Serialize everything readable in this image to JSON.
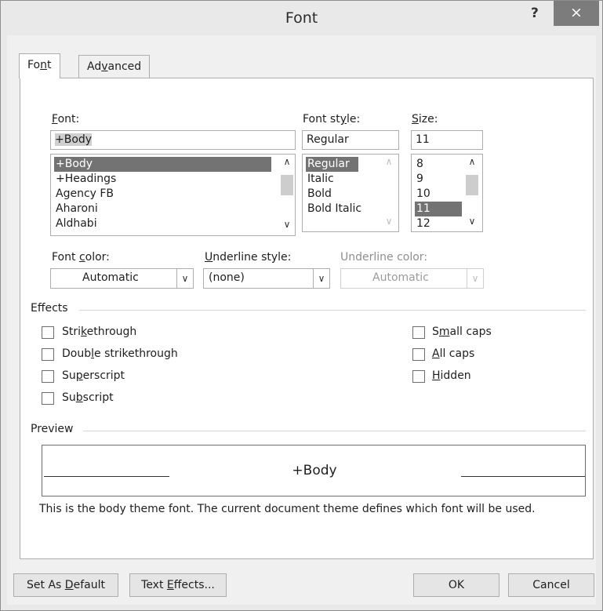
{
  "window": {
    "title": "Font",
    "help_icon": "?",
    "close_icon": "×"
  },
  "tabs": [
    {
      "label": "Font",
      "active": true
    },
    {
      "label": "Advanced",
      "active": false
    }
  ],
  "font": {
    "label": "Font:",
    "value": "+Body",
    "items": [
      "+Body",
      "+Headings",
      "Agency FB",
      "Aharoni",
      "Aldhabi"
    ],
    "selected": "+Body"
  },
  "font_style": {
    "label": "Font style:",
    "value": "Regular",
    "items": [
      "Regular",
      "Italic",
      "Bold",
      "Bold Italic"
    ],
    "selected": "Regular"
  },
  "size": {
    "label": "Size:",
    "value": "11",
    "items": [
      "8",
      "9",
      "10",
      "11",
      "12"
    ],
    "selected": "11"
  },
  "font_color": {
    "label": "Font color:",
    "value": "Automatic"
  },
  "underline_style": {
    "label": "Underline style:",
    "value": "(none)"
  },
  "underline_color": {
    "label": "Underline color:",
    "value": "Automatic",
    "disabled": true
  },
  "effects": {
    "heading": "Effects",
    "left": [
      {
        "label": "Strikethrough",
        "checked": false
      },
      {
        "label": "Double strikethrough",
        "checked": false
      },
      {
        "label": "Superscript",
        "checked": false
      },
      {
        "label": "Subscript",
        "checked": false
      }
    ],
    "right": [
      {
        "label": "Small caps",
        "checked": false
      },
      {
        "label": "All caps",
        "checked": false
      },
      {
        "label": "Hidden",
        "checked": false
      }
    ]
  },
  "preview": {
    "heading": "Preview",
    "sample": "+Body",
    "description": "This is the body theme font. The current document theme defines which font will be used."
  },
  "buttons": {
    "set_default": "Set As Default",
    "text_effects": "Text Effects...",
    "ok": "OK",
    "cancel": "Cancel"
  },
  "icons": {
    "up_arrow": "∧",
    "down_arrow": "∨",
    "dropdown_arrow": "∨"
  },
  "colors": {
    "selection": "#737373",
    "close_button": "#7c7c7c"
  }
}
